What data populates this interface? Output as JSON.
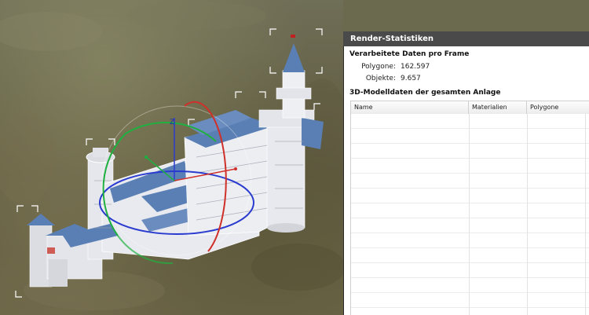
{
  "panel": {
    "title": "Render-Statistiken",
    "frame_section_title": "Verarbeitete Daten pro Frame",
    "stats": [
      {
        "label": "Polygone:",
        "value": "162.597"
      },
      {
        "label": "Objekte:",
        "value": "9.657"
      }
    ],
    "model_section_title": "3D-Modelldaten der gesamten Anlage",
    "table": {
      "columns": [
        "Name",
        "Materialien",
        "Polygone"
      ],
      "rows": []
    }
  },
  "viewport": {
    "gizmo_axis_label": "Z",
    "colors": {
      "roof": "#5a7fb4",
      "wall": "#e7e8ec",
      "gizmo_green": "#1fb040",
      "gizmo_red": "#d0302a",
      "gizmo_blue": "#2a3bd0"
    }
  }
}
